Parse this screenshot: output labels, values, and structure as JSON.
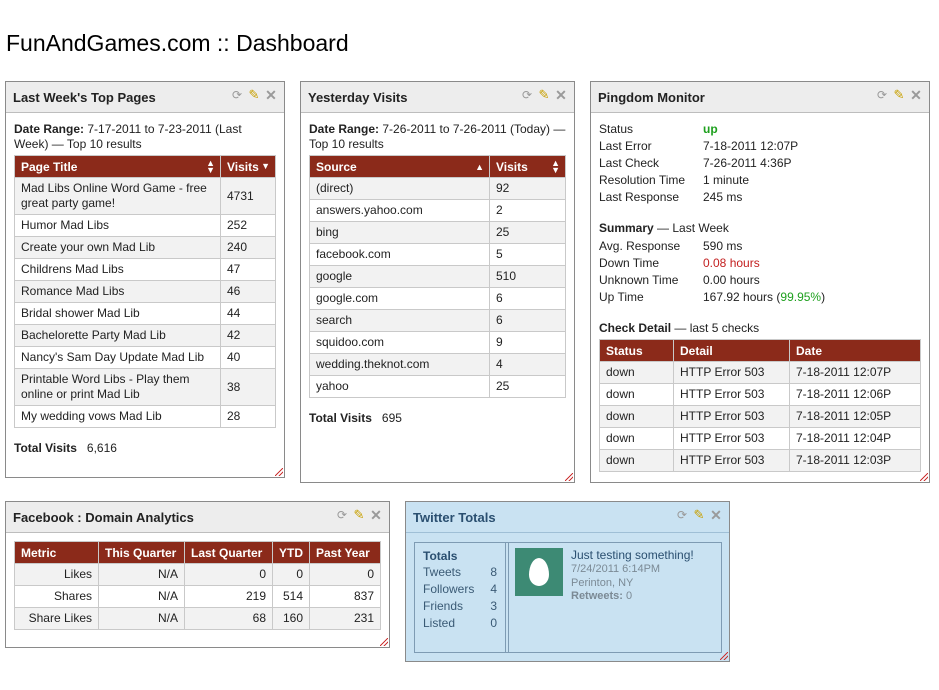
{
  "page": {
    "title": "FunAndGames.com :: Dashboard"
  },
  "top_pages": {
    "title": "Last Week's Top Pages",
    "date_label": "Date Range:",
    "date_text": " 7-17-2011 to 7-23-2011 (Last Week) — Top 10 results",
    "columns": [
      "Page Title",
      "Visits"
    ],
    "rows": [
      [
        "Mad Libs Online Word Game - free great party game!",
        "4731"
      ],
      [
        "Humor Mad Libs",
        "252"
      ],
      [
        "Create your own Mad Lib",
        "240"
      ],
      [
        "Childrens Mad Libs",
        "47"
      ],
      [
        "Romance Mad Libs",
        "46"
      ],
      [
        "Bridal shower Mad Lib",
        "44"
      ],
      [
        "Bachelorette Party Mad Lib",
        "42"
      ],
      [
        "Nancy's Sam Day Update Mad Lib",
        "40"
      ],
      [
        "Printable Word Libs - Play them online or print Mad Lib",
        "38"
      ],
      [
        "My wedding vows Mad Lib",
        "28"
      ]
    ],
    "total_label": "Total Visits",
    "total_value": "6,616"
  },
  "yesterday": {
    "title": "Yesterday Visits",
    "date_label": "Date Range:",
    "date_text": " 7-26-2011 to 7-26-2011 (Today) — Top 10 results",
    "columns": [
      "Source",
      "Visits"
    ],
    "rows": [
      [
        "(direct)",
        "92"
      ],
      [
        "answers.yahoo.com",
        "2"
      ],
      [
        "bing",
        "25"
      ],
      [
        "facebook.com",
        "5"
      ],
      [
        "google",
        "510"
      ],
      [
        "google.com",
        "6"
      ],
      [
        "search",
        "6"
      ],
      [
        "squidoo.com",
        "9"
      ],
      [
        "wedding.theknot.com",
        "4"
      ],
      [
        "yahoo",
        "25"
      ]
    ],
    "total_label": "Total Visits",
    "total_value": "695"
  },
  "pingdom": {
    "title": "Pingdom Monitor",
    "status": [
      [
        "Status",
        "up"
      ],
      [
        "Last Error",
        "7-18-2011 12:07P"
      ],
      [
        "Last Check",
        "7-26-2011 4:36P"
      ],
      [
        "Resolution Time",
        "1 minute"
      ],
      [
        "Last Response",
        "245 ms"
      ]
    ],
    "summary_label": "Summary",
    "summary_suffix": " — Last Week",
    "summary": [
      [
        "Avg. Response",
        "590 ms"
      ],
      [
        "Down Time",
        "0.08 hours"
      ],
      [
        "Unknown Time",
        "0.00 hours"
      ],
      [
        "Up Time",
        "167.92 hours ("
      ]
    ],
    "uptime_pct": "99.95%",
    "uptime_close": ")",
    "check_label": "Check Detail",
    "check_suffix": " — last 5 checks",
    "check_columns": [
      "Status",
      "Detail",
      "Date"
    ],
    "checks": [
      [
        "down",
        "HTTP Error 503",
        "7-18-2011 12:07P"
      ],
      [
        "down",
        "HTTP Error 503",
        "7-18-2011 12:06P"
      ],
      [
        "down",
        "HTTP Error 503",
        "7-18-2011 12:05P"
      ],
      [
        "down",
        "HTTP Error 503",
        "7-18-2011 12:04P"
      ],
      [
        "down",
        "HTTP Error 503",
        "7-18-2011 12:03P"
      ]
    ],
    "colors": {
      "up": "#1ea01e",
      "down": "#c32020"
    }
  },
  "facebook": {
    "title": "Facebook : Domain Analytics",
    "columns": [
      "Metric",
      "This Quarter",
      "Last Quarter",
      "YTD",
      "Past Year"
    ],
    "rows": [
      [
        "Likes",
        "N/A",
        "0",
        "0",
        "0"
      ],
      [
        "Shares",
        "N/A",
        "219",
        "514",
        "837"
      ],
      [
        "Share Likes",
        "N/A",
        "68",
        "160",
        "231"
      ]
    ]
  },
  "twitter": {
    "title": "Twitter Totals",
    "totals_label": "Totals",
    "totals": [
      [
        "Tweets",
        "8"
      ],
      [
        "Followers",
        "4"
      ],
      [
        "Friends",
        "3"
      ],
      [
        "Listed",
        "0"
      ]
    ],
    "tweet": {
      "text": "Just testing something!",
      "date": "7/24/2011 6:14PM",
      "location": "Perinton, NY",
      "retweets_label": "Retweets:",
      "retweets_value": " 0"
    }
  },
  "theme": {
    "header_red": "#8b2a1a",
    "twitter_bg": "#c9e2f2"
  }
}
